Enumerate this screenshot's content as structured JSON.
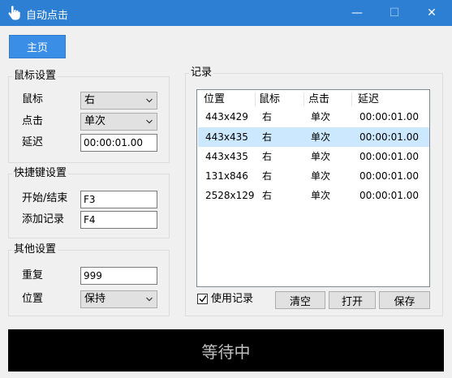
{
  "window": {
    "title": "自动点击",
    "minimize": "—",
    "maximize": "☐",
    "close": "✕",
    "icon": "hand-pointer-icon"
  },
  "home_button": "主页",
  "mouse_settings": {
    "title": "鼠标设置",
    "mouse_label": "鼠标",
    "mouse_value": "右",
    "click_label": "点击",
    "click_value": "单次",
    "delay_label": "延迟",
    "delay_value": "00:00:01.00"
  },
  "hotkey_settings": {
    "title": "快捷键设置",
    "start_stop_label": "开始/结束",
    "start_stop_value": "F3",
    "add_record_label": "添加记录",
    "add_record_value": "F4"
  },
  "other_settings": {
    "title": "其他设置",
    "repeat_label": "重复",
    "repeat_value": "999",
    "position_label": "位置",
    "position_value": "保持"
  },
  "records": {
    "title": "记录",
    "columns": [
      "位置",
      "鼠标",
      "点击",
      "延迟"
    ],
    "rows": [
      [
        "443x429",
        "右",
        "单次",
        "00:00:01.00"
      ],
      [
        "443x435",
        "右",
        "单次",
        "00:00:01.00"
      ],
      [
        "443x435",
        "右",
        "单次",
        "00:00:01.00"
      ],
      [
        "131x846",
        "右",
        "单次",
        "00:00:01.00"
      ],
      [
        "2528x129",
        "右",
        "单次",
        "00:00:01.00"
      ]
    ],
    "selected_row": 2,
    "use_records_label": "使用记录",
    "use_records_checked": true,
    "clear_button": "清空",
    "open_button": "打开",
    "save_button": "保存"
  },
  "status": "等待中",
  "colors": {
    "titlebar": "#2d7fd3",
    "accent_button": "#3b8ee6",
    "selection": "#cce8ff",
    "status_bg": "#000000"
  }
}
